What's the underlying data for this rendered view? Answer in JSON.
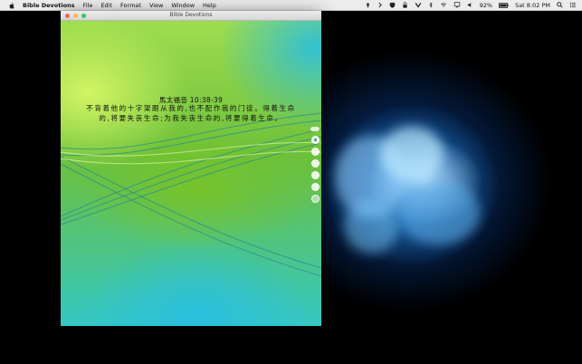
{
  "menubar": {
    "app_name": "Bible Devotions",
    "menus": [
      "File",
      "Edit",
      "Format",
      "View",
      "Window",
      "Help"
    ],
    "battery": "92%",
    "clock": "Sat 8:02 PM"
  },
  "window": {
    "title": "Bible Devotions"
  },
  "verse": {
    "reference": "馬太福音 10:38-39",
    "lines": [
      "不背着他的十字架跟从我的,也不配作我的门徒。得着生命",
      "的,将要失丧生命;为我失丧生命的,将要得着生命。"
    ]
  }
}
